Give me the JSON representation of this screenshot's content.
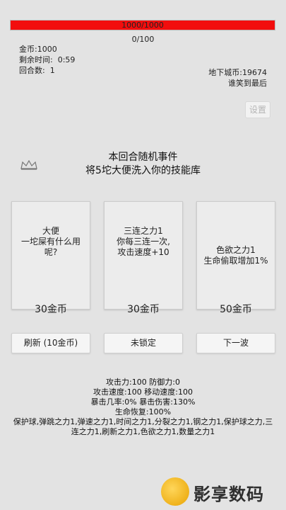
{
  "hp": {
    "text": "1000/1000",
    "fraction": 1.0,
    "color": "#f20d0d"
  },
  "xp": {
    "text": "0/100"
  },
  "stats_left": {
    "gold": "金币:1000",
    "time": "剩余时间:  0:59",
    "round": "回合数:  1"
  },
  "stats_right": {
    "dungeon_coins": "地下城币:19674",
    "tagline": "谁笑到最后"
  },
  "settings_label": "设置",
  "event": {
    "line1": "本回合随机事件",
    "line2": "将5坨大便洗入你的技能库"
  },
  "cards": [
    {
      "text_lines": [
        "大便",
        "一坨屎有什么用",
        "呢?"
      ],
      "price": "30金币"
    },
    {
      "text_lines": [
        "三连之力1",
        "你每三连一次,",
        "攻击速度+10"
      ],
      "price": "30金币"
    },
    {
      "text_lines": [
        "色欲之力1",
        "生命偷取增加1%"
      ],
      "price": "50金币"
    }
  ],
  "buttons": {
    "refresh": "刷新 (10金币)",
    "lock": "未锁定",
    "next_wave": "下一波"
  },
  "player_stats": {
    "line1": "攻击力:100 防御力:0",
    "line2": "攻击速度:100 移动速度:100",
    "line3": "暴击几率:0% 暴击伤害:130%",
    "line4": "生命恢复:100%",
    "skills": "保护球,弹跳之力1,弹速之力1,时间之力1,分裂之力1,钢之力1,保护球之力,三连之力1,刷新之力1,色欲之力1,数量之力1"
  },
  "logo": {
    "text": "影享数码"
  }
}
